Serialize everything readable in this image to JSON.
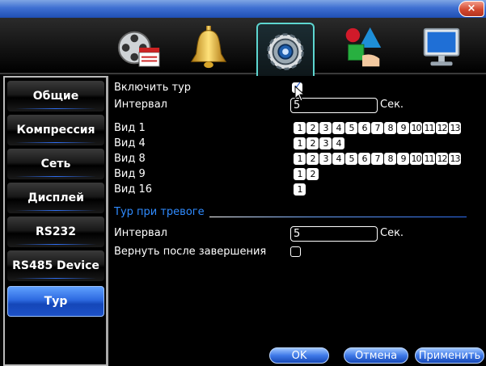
{
  "window": {
    "close_glyph": "×"
  },
  "top_tabs": [
    {
      "name": "record-tab",
      "icon": "film-clapper-icon"
    },
    {
      "name": "alarm-tab",
      "icon": "bell-icon"
    },
    {
      "name": "system-tab",
      "icon": "gear-icon",
      "active": true
    },
    {
      "name": "advanced-tab",
      "icon": "blocks-icon"
    },
    {
      "name": "info-tab",
      "icon": "monitor-icon"
    }
  ],
  "sidebar": {
    "items": [
      {
        "label": "Общие"
      },
      {
        "label": "Компрессия"
      },
      {
        "label": "Сеть"
      },
      {
        "label": "Дисплей"
      },
      {
        "label": "RS232"
      },
      {
        "label": "RS485 Device"
      },
      {
        "label": "Тур",
        "active": true
      }
    ]
  },
  "tour": {
    "enable_label": "Включить тур",
    "enable_checked": true,
    "interval_label": "Интервал",
    "interval_value": "5",
    "interval_unit": "Сек.",
    "views": [
      {
        "label": "Вид 1",
        "channels": [
          "1",
          "2",
          "3",
          "4",
          "5",
          "6",
          "7",
          "8",
          "9",
          "10",
          "11",
          "12",
          "13"
        ],
        "selected": [
          "1",
          "2",
          "3",
          "4",
          "5",
          "6",
          "7",
          "8",
          "9",
          "10",
          "11",
          "12",
          "13"
        ]
      },
      {
        "label": "Вид 4",
        "channels": [
          "1",
          "2",
          "3",
          "4"
        ],
        "selected": [
          "1",
          "2",
          "3",
          "4"
        ]
      },
      {
        "label": "Вид 8",
        "channels": [
          "1",
          "2",
          "3",
          "4",
          "5",
          "6",
          "7",
          "8",
          "9",
          "10",
          "11",
          "12",
          "13"
        ],
        "selected": [
          "1",
          "2",
          "3",
          "4",
          "5",
          "6",
          "7",
          "8",
          "9",
          "10",
          "11",
          "12",
          "13"
        ]
      },
      {
        "label": "Вид 9",
        "channels": [
          "1",
          "2"
        ],
        "selected": [
          "1",
          "2"
        ]
      },
      {
        "label": "Вид 16",
        "channels": [
          "1"
        ],
        "selected": [
          "1"
        ]
      }
    ]
  },
  "alarm_tour": {
    "section_title": "Тур при тревоге",
    "interval_label": "Интервал",
    "interval_value": "5",
    "interval_unit": "Сек.",
    "return_label": "Вернуть после завершения",
    "return_checked": false
  },
  "buttons": {
    "ok": "OK",
    "cancel": "Отмена",
    "apply": "Применить"
  },
  "colors": {
    "accent": "#2f6ff5",
    "section_title": "#2f8bff",
    "close": "#d2482f"
  }
}
